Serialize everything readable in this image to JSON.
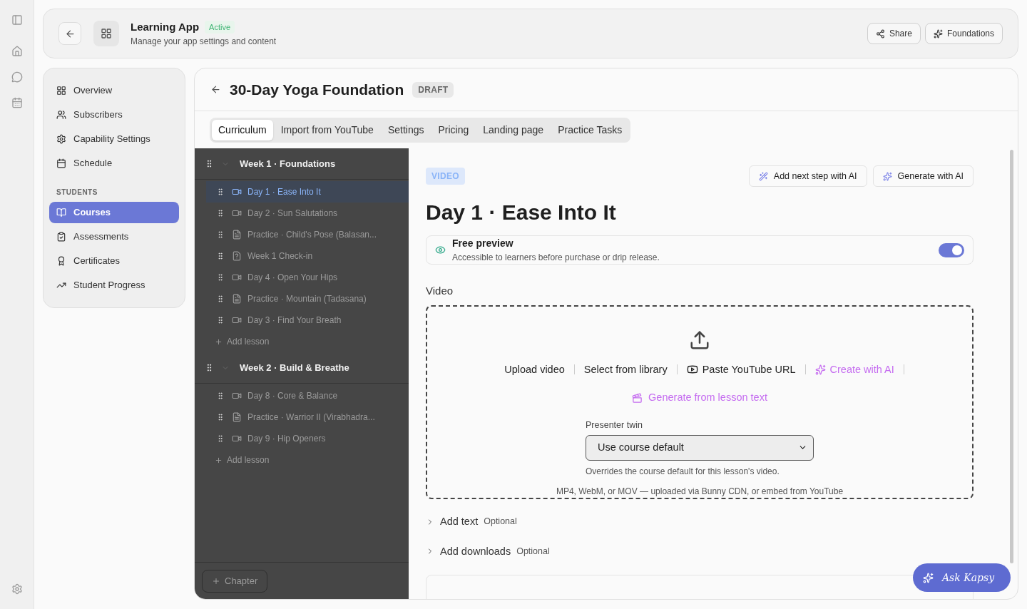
{
  "app": {
    "title": "Learning App",
    "status": "Active",
    "subtitle": "Manage your app settings and content"
  },
  "header_buttons": [
    {
      "label": "Share",
      "kind": "share"
    },
    {
      "label": "Foundations",
      "kind": "ai"
    }
  ],
  "nav": {
    "items": [
      {
        "label": "Overview",
        "selected": false
      },
      {
        "label": "Subscribers",
        "selected": false
      },
      {
        "label": "Capability Settings",
        "selected": false
      },
      {
        "label": "Schedule",
        "selected": false
      }
    ],
    "section_label": "STUDENTS",
    "section_items": [
      {
        "label": "Courses",
        "selected": true
      },
      {
        "label": "Assessments",
        "selected": false
      },
      {
        "label": "Certificates",
        "selected": false
      },
      {
        "label": "Student Progress",
        "selected": false
      }
    ]
  },
  "course": {
    "title": "30-Day Yoga Foundation",
    "badge": "DRAFT"
  },
  "tabs": [
    {
      "label": "Curriculum",
      "selected": true
    },
    {
      "label": "Import from YouTube",
      "selected": false
    },
    {
      "label": "Settings",
      "selected": false
    },
    {
      "label": "Pricing",
      "selected": false
    },
    {
      "label": "Landing page",
      "selected": false
    },
    {
      "label": "Practice Tasks",
      "selected": false
    }
  ],
  "chapters": [
    {
      "title": "Week 1 · Foundations",
      "expanded": true,
      "add_label": "Add lesson",
      "lessons": [
        {
          "title": "Day 1 · Ease Into It",
          "kind": "video",
          "selected": true
        },
        {
          "title": "Day 2 · Sun Salutations",
          "kind": "video",
          "selected": false
        },
        {
          "title": "Practice · Child's Pose (Balasan...",
          "kind": "doc",
          "selected": false
        },
        {
          "title": "Week 1 Check-in",
          "kind": "quiz",
          "selected": false
        },
        {
          "title": "Day 4 · Open Your Hips",
          "kind": "video",
          "selected": false
        },
        {
          "title": "Practice · Mountain (Tadasana)",
          "kind": "doc",
          "selected": false
        },
        {
          "title": "Day 3 · Find Your Breath",
          "kind": "video",
          "selected": false
        }
      ]
    },
    {
      "title": "Week 2 · Build & Breathe",
      "expanded": true,
      "add_label": "Add lesson",
      "lessons": [
        {
          "title": "Day 8 · Core & Balance",
          "kind": "video",
          "selected": false
        },
        {
          "title": "Practice · Warrior II (Virabhadra...",
          "kind": "doc",
          "selected": false
        },
        {
          "title": "Day 9 · Hip Openers",
          "kind": "video",
          "selected": false
        }
      ]
    }
  ],
  "chapter_button": "Chapter",
  "lesson": {
    "type_badge": "VIDEO",
    "title": "Day 1 · Ease Into It",
    "ai_buttons": [
      {
        "label": "Add next step with AI",
        "kind": "wand"
      },
      {
        "label": "Generate with AI",
        "kind": "sparkle"
      }
    ],
    "free_preview": {
      "title": "Free preview",
      "description": "Accessible to learners before purchase or drip release.",
      "on": true
    },
    "video_label": "Video",
    "upload": {
      "options": [
        {
          "label": "Upload video",
          "kind": "plain"
        },
        {
          "label": "Select from library",
          "kind": "plain"
        },
        {
          "label": "Paste YouTube URL",
          "kind": "youtube"
        },
        {
          "label": "Create with AI",
          "kind": "ai"
        }
      ],
      "generate": "Generate from lesson text",
      "presenter_label": "Presenter twin",
      "presenter_value": "Use course default",
      "presenter_hint": "Overrides the course default for this lesson's video.",
      "formats": "MP4, WebM, or MOV — uploaded via Bunny CDN, or embed from YouTube"
    },
    "sections": [
      {
        "label": "Add text",
        "optional": "Optional",
        "expanded": false
      },
      {
        "label": "Add downloads",
        "optional": "Optional",
        "expanded": false
      }
    ]
  },
  "assistant": "Ask Kapsy"
}
